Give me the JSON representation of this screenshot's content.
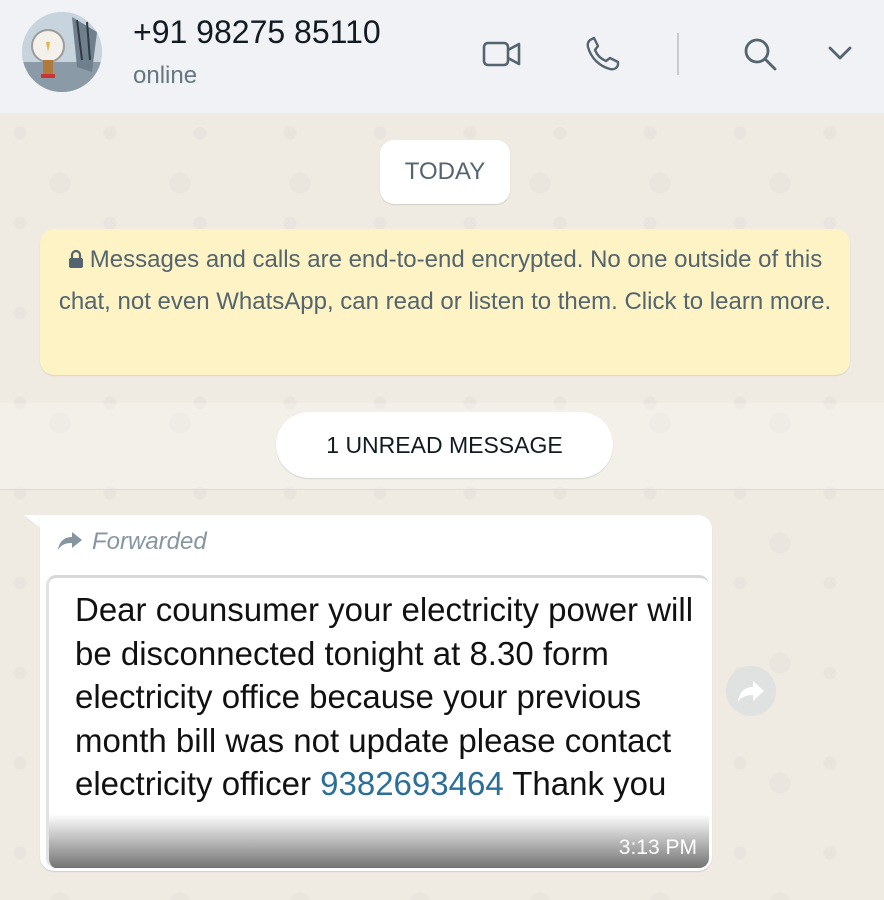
{
  "header": {
    "contact_name": "+91 98275 85110",
    "status": "online",
    "icons": [
      "video-call-icon",
      "voice-call-icon",
      "search-icon",
      "chevron-down-icon"
    ]
  },
  "chat": {
    "date_pill": "TODAY",
    "encryption_notice": "Messages and calls are end-to-end encrypted. No one outside of this chat, not even WhatsApp, can read or listen to them. Click to learn more.",
    "unread_label": "1 UNREAD MESSAGE",
    "message": {
      "forwarded_label": "Forwarded",
      "text_before_link": "Dear counsumer your electricity power will be disconnected tonight at 8.30 form electricity office because your previous month bill was not update please contact electricity officer ",
      "link_number": "9382693464",
      "text_after_link": " Thank you",
      "time": "3:13 PM"
    }
  },
  "colors": {
    "header_bg": "#f0f2f5",
    "chat_bg": "#efeae2",
    "encryption_bg": "#fdf3c5",
    "link": "#2b6f96",
    "muted_text": "#667781"
  }
}
